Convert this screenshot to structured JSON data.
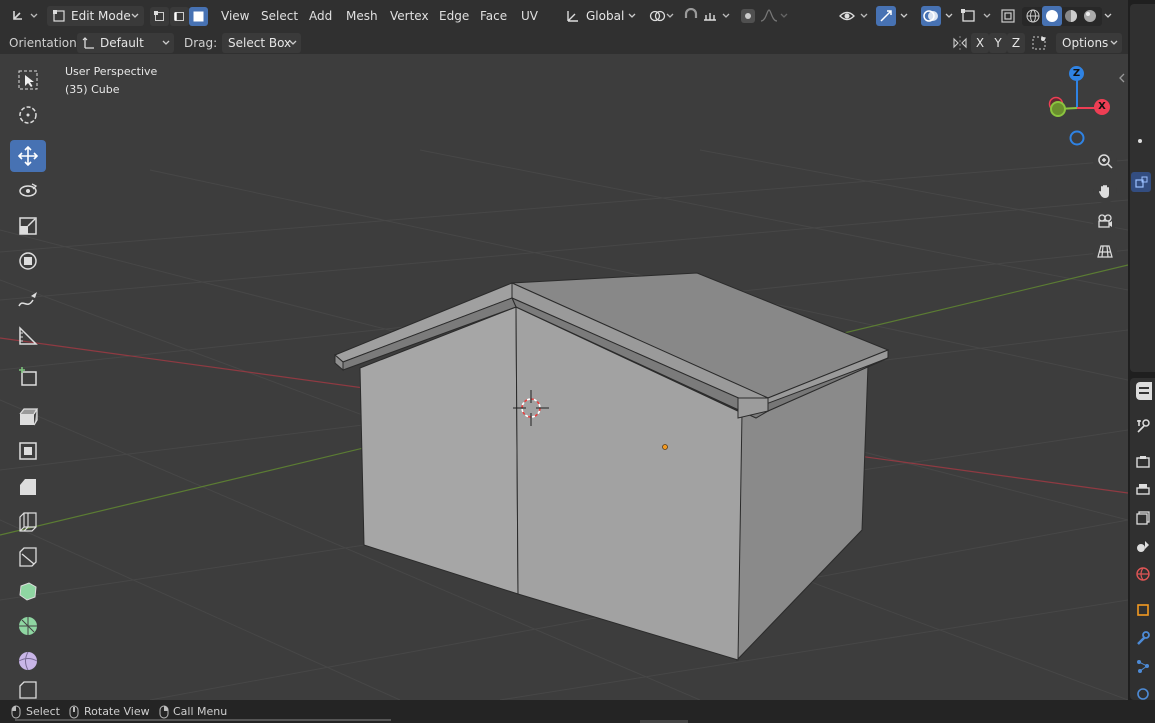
{
  "header": {
    "mode_label": "Edit Mode",
    "menus": [
      "View",
      "Select",
      "Add",
      "Mesh",
      "Vertex",
      "Edge",
      "Face",
      "UV"
    ],
    "transform_orientation": "Global"
  },
  "tool_settings": {
    "orientation_label": "Orientation:",
    "orientation_value": "Default",
    "drag_label": "Drag:",
    "drag_value": "Select Box",
    "axis_x": "X",
    "axis_y": "Y",
    "axis_z": "Z",
    "options_label": "Options"
  },
  "viewport": {
    "view_name": "User Perspective",
    "object_info": "(35) Cube",
    "gizmo": {
      "x": "X",
      "y": "Y",
      "z": "Z"
    }
  },
  "status_bar": {
    "select": "Select",
    "rotate": "Rotate View",
    "call_menu": "Call Menu"
  },
  "colors": {
    "accent": "#4772b3",
    "axis_x": "#ee3e54",
    "axis_y": "#8bc43f",
    "axis_z": "#2f83e4",
    "viewport_bg": "#3d3d3d",
    "origin_dot": "#f29a22"
  }
}
